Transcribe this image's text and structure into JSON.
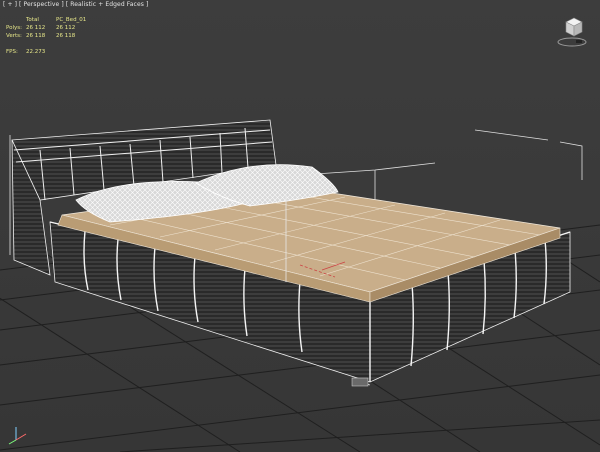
{
  "viewport": {
    "label_segments": [
      "[ + ]",
      "[ Perspective ]",
      "[ Realistic + Edged Faces ]"
    ]
  },
  "stats": {
    "header_label": "Total",
    "header_selection": "PC_Bed_01",
    "polys_label": "Polys:",
    "polys_total": "26 112",
    "polys_selection": "26 112",
    "verts_label": "Verts:",
    "verts_total": "26 118",
    "verts_selection": "26 118",
    "fps_label": "FPS:",
    "fps_value": "22.273"
  },
  "colors": {
    "grid": "#1e1e1e",
    "wire": "#f2f2f2",
    "mattress": "#c9ae8a",
    "base": "#2b2b2b",
    "stats_text": "#e8e88a"
  },
  "icons": {
    "viewcube": "viewcube-icon",
    "axis_tripod": "axis-tripod-icon"
  }
}
